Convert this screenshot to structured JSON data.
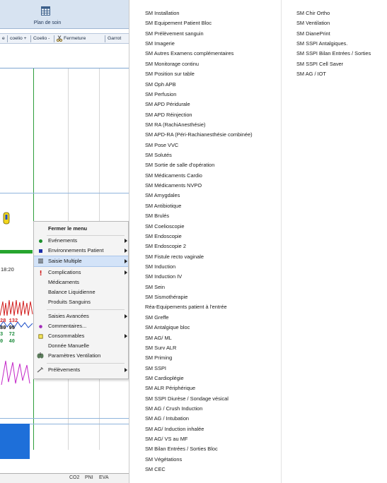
{
  "plan_header": {
    "label": "Plan de soin",
    "icon": "grid-calendar-icon"
  },
  "toolbar": {
    "items": [
      "e",
      "coelio +",
      "Coelio -",
      "Fermeture",
      "Garrot"
    ],
    "close_icon": "scissors-icon"
  },
  "timeline": {
    "time": "18:20"
  },
  "vitals": {
    "rows": [
      {
        "a": "28",
        "b": "132",
        "color_a": "#d22020",
        "color_b": "#d22020"
      },
      {
        "a": "80",
        "b": "95",
        "color_a": "#000000",
        "color_b": "#000000"
      },
      {
        "a": "3",
        "b": "72",
        "color_a": "#1a8a3a",
        "color_b": "#1a8a3a"
      },
      {
        "a": "0",
        "b": "40",
        "color_a": "#1a8a3a",
        "color_b": "#1a8a3a"
      }
    ]
  },
  "bottom_bar": {
    "items": [
      "CO2",
      "PNI",
      "EVA"
    ]
  },
  "context_menu": {
    "title": "Fermer le menu",
    "items": [
      {
        "label": "Evénements",
        "icon": "green-dot-icon",
        "submenu": true
      },
      {
        "label": "Environnements Patient",
        "icon": "blue-square-icon",
        "submenu": true
      },
      {
        "label": "Saisie Multiple",
        "icon": "list-icon",
        "submenu": true,
        "highlighted": true
      },
      {
        "label": "Complications",
        "icon": "exclamation-icon",
        "submenu": true
      },
      {
        "label": "Médicaments",
        "icon": "",
        "submenu": false
      },
      {
        "label": "Balance Liquidienne",
        "icon": "",
        "submenu": false
      },
      {
        "label": "Produits Sanguins",
        "icon": "",
        "submenu": false
      },
      {
        "label": "Saisies Avancées",
        "icon": "",
        "submenu": true
      },
      {
        "label": "Commentaires...",
        "icon": "purple-dot-icon",
        "submenu": false
      },
      {
        "label": "Consommables",
        "icon": "yellow-square-icon",
        "submenu": true
      },
      {
        "label": "Donnée Manuelle",
        "icon": "",
        "submenu": false
      },
      {
        "label": "Paramètres Ventilation",
        "icon": "lungs-icon",
        "submenu": false
      },
      {
        "label": "Prélèvements",
        "icon": "syringe-icon",
        "submenu": true
      }
    ]
  },
  "submenu": {
    "column1": [
      "SM Installation",
      "SM Equipement Patient Bloc",
      "SM Prélèvement sanguin",
      "SM Imagerie",
      "SM Autres Examens complémentaires",
      "SM Monitorage continu",
      "SM Position sur table",
      "SM Oph APB",
      "SM Perfusion",
      "SM APD Péridurale",
      "SM APD Réinjection",
      "SM RA (RachiAnesthésie)",
      "SM APD-RA (Péri-Rachianesthésie combinée)",
      "SM Pose VVC",
      "SM Solutés",
      "SM Sortie de salle d'opération",
      "SM Médicaments Cardio",
      "SM Médicaments NVPO",
      "SM Amygdales",
      "SM Antibiotique",
      "SM Brulés",
      "SM Coelioscopie",
      "SM Endoscopie",
      "SM Endoscopie 2",
      "SM Fistule recto vaginale",
      "SM Induction",
      "SM Induction IV",
      "SM Sein",
      "SM Sismothérapie",
      "Réa-Equipements patient à l'entrée",
      "SM Greffe",
      "SM Antalgique bloc",
      "SM AG/ ML",
      "SM Surv ALR",
      "SM Priming",
      "SM SSPI",
      "SM Cardioplégie",
      "SM ALR Périphérique",
      "SM SSPI Diurèse / Sondage vésical",
      "SM AG / Crush Induction",
      "SM AG / Intubation",
      "SM AG/ Induction inhalée",
      "SM AG/ VS au MF",
      "SM Bilan Entrées / Sorties Bloc",
      "SM Végétations",
      "SM CEC"
    ],
    "column2": [
      "SM Chir Ortho",
      "SM Ventilation",
      "SM DianePrint",
      "SM SSPI Antalgiques.",
      "SM SSPI Bilan Entrées / Sorties",
      "SM SSPI Cell Saver",
      "SM AG / IOT"
    ]
  }
}
